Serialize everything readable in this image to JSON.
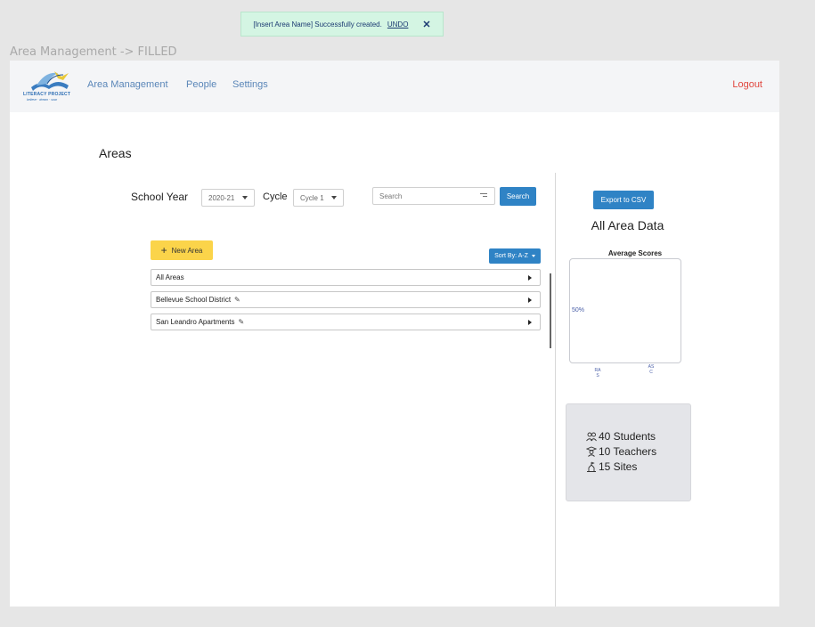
{
  "frame_label": "Area Management -> FILLED",
  "toast": {
    "message": "[Insert Area Name] Successfully created.",
    "undo_label": "UNDO",
    "close_glyph": "✕"
  },
  "logo": {
    "name": "LITERACY PROJECT",
    "tagline": "believe · dream · soar"
  },
  "nav": {
    "items": [
      "Area Management",
      "People",
      "Settings"
    ],
    "logout": "Logout"
  },
  "page": {
    "title": "Areas"
  },
  "filters": {
    "school_year_label": "School Year",
    "school_year_value": "2020-21",
    "cycle_label": "Cycle",
    "cycle_value": "Cycle 1",
    "search_placeholder": "Search",
    "search_button": "Search"
  },
  "toolbar": {
    "new_area_label": "New Area",
    "new_area_icon": "+",
    "sort_label": "Sort By: A-Z"
  },
  "areas": [
    {
      "name": "All Areas",
      "editable": false
    },
    {
      "name": "Bellevue School District",
      "editable": true
    },
    {
      "name": "San Leandro Apartments",
      "editable": true
    }
  ],
  "sidebar": {
    "export_button": "Export to CSV",
    "title": "All Area Data"
  },
  "chart_data": {
    "type": "bar",
    "title": "Average Scores",
    "categories": [
      "RAS",
      "ASC"
    ],
    "ytick_labels": [
      "50%"
    ],
    "values": [],
    "tick_label_lines": [
      [
        "RA",
        "S"
      ],
      [
        "AS",
        "C"
      ]
    ]
  },
  "stats": {
    "students": "40 Students",
    "teachers": "10 Teachers",
    "sites": "15 Sites"
  },
  "colors": {
    "accent": "#2f83c5",
    "new_button": "#fbd44a",
    "logout": "#e0453d",
    "toast_bg": "#d4f5e3"
  }
}
